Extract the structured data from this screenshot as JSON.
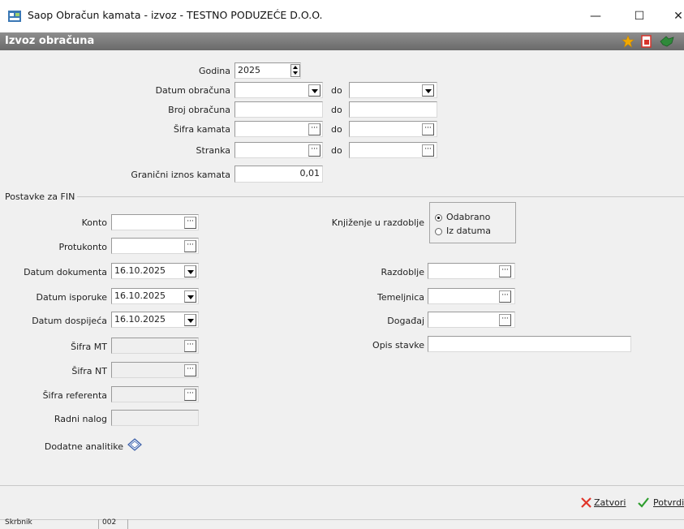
{
  "window": {
    "title": "Saop Obračun kamata - izvoz - TESTNO PODUZEĆE D.O.O.",
    "minimize": "—",
    "maximize": "☐",
    "close": "✕"
  },
  "header": {
    "title": "Izvoz obračuna",
    "icons": [
      "star-icon",
      "document-icon",
      "shape-icon"
    ]
  },
  "filters": {
    "godina_label": "Godina",
    "godina_value": "2025",
    "datum_obracuna_label": "Datum obračuna",
    "broj_obracuna_label": "Broj obračuna",
    "sifra_kamata_label": "Šifra kamata",
    "stranka_label": "Stranka",
    "granicni_iznos_label": "Granični iznos kamata",
    "granicni_iznos_value": "0,01",
    "do_label": "do"
  },
  "postavke": {
    "section_label": "Postavke za FIN",
    "konto_label": "Konto",
    "protukonto_label": "Protukonto",
    "datum_dokumenta_label": "Datum dokumenta",
    "datum_dokumenta_value": "16.10.2025",
    "datum_isporuke_label": "Datum isporuke",
    "datum_isporuke_value": "16.10.2025",
    "datum_dospijeca_label": "Datum dospijeća",
    "datum_dospijeca_value": "16.10.2025",
    "sifra_mt_label": "Šifra MT",
    "sifra_nt_label": "Šifra NT",
    "sifra_referenta_label": "Šifra referenta",
    "radni_nalog_label": "Radni nalog",
    "dodatne_analitike_label": "Dodatne analitike",
    "knjizenje_label": "Knjiženje u razdoblje",
    "radio_odabrano": "Odabrano",
    "radio_iz_datuma": "Iz datuma",
    "radio_selected": "Odabrano",
    "razdoblje_label": "Razdoblje",
    "temeljnica_label": "Temeljnica",
    "dogadaj_label": "Događaj",
    "opis_stavke_label": "Opis stavke"
  },
  "footer": {
    "zatvori": "Zatvori",
    "potvrdi": "Potvrdi"
  },
  "status": {
    "user_label": "Skrbnik",
    "code": "002"
  },
  "colors": {
    "header_bg": "#7d7d7d",
    "close_red": "#e0362a",
    "confirm_green": "#2e9e2e",
    "star_gold": "#f2a900",
    "doc_red": "#d8332a",
    "shape_green": "#2f8a3a"
  }
}
